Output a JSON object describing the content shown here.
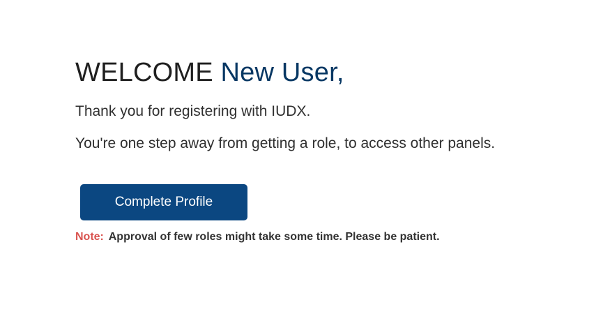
{
  "welcome": {
    "greeting": "WELCOME",
    "user_name": "New User,"
  },
  "messages": {
    "line1": "Thank you for registering with IUDX.",
    "line2": "You're one step away from getting a role, to access other panels."
  },
  "actions": {
    "complete_profile_label": "Complete Profile"
  },
  "note": {
    "label": "Note:",
    "text": "Approval of few roles might take some time. Please be patient."
  },
  "colors": {
    "user_name": "#073763",
    "button_bg": "#0b4781",
    "note_label": "#d9534f"
  }
}
